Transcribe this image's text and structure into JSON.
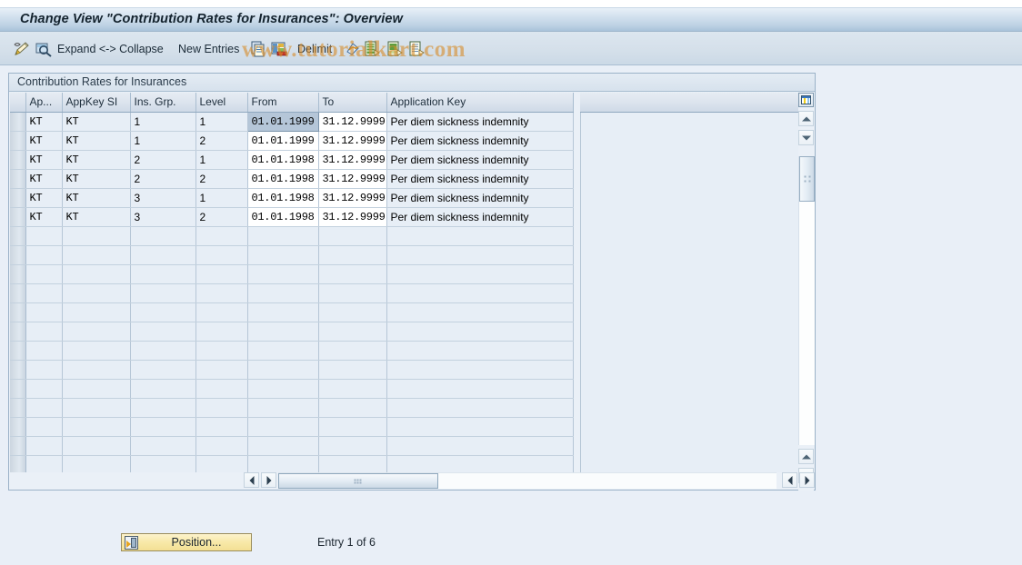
{
  "window": {
    "title": "Change View \"Contribution Rates for Insurances\": Overview"
  },
  "watermark": {
    "text": "www.tutorialkart.com"
  },
  "toolbar": {
    "items": [
      {
        "name": "display-change-icon",
        "label": "",
        "icon": "pencil-icon"
      },
      {
        "name": "display-detail-icon",
        "label": "",
        "icon": "magnifier-icon"
      },
      {
        "name": "expand-collapse",
        "label": "Expand <-> Collapse",
        "icon": ""
      },
      {
        "name": "new-entries",
        "label": "New Entries",
        "icon": ""
      },
      {
        "name": "copy-as-icon",
        "label": "",
        "icon": "copy-icon"
      },
      {
        "name": "delete-icon",
        "label": "",
        "icon": "delete-row-icon"
      },
      {
        "name": "delimit",
        "label": "Delimit",
        "icon": ""
      },
      {
        "name": "undo-icon",
        "label": "",
        "icon": "undo-icon"
      },
      {
        "name": "previous-entry-icon",
        "label": "",
        "icon": "document-prev-icon"
      },
      {
        "name": "select-all-icon",
        "label": "",
        "icon": "document-select-icon"
      },
      {
        "name": "next-entry-icon",
        "label": "",
        "icon": "document-next-icon"
      }
    ]
  },
  "panel": {
    "header": "Contribution Rates for Insurances"
  },
  "table": {
    "columns": [
      {
        "key": "ap",
        "label": "Ap..."
      },
      {
        "key": "app",
        "label": "AppKey SI"
      },
      {
        "key": "ins",
        "label": "Ins. Grp."
      },
      {
        "key": "lvl",
        "label": "Level"
      },
      {
        "key": "from",
        "label": "From"
      },
      {
        "key": "to",
        "label": "To"
      },
      {
        "key": "key",
        "label": "Application Key"
      }
    ],
    "rows": [
      {
        "ap": "KT",
        "app": "KT",
        "ins": "1",
        "lvl": "1",
        "from": "01.01.1999",
        "to": "31.12.9999",
        "key": "Per diem sickness indemnity",
        "selected": true
      },
      {
        "ap": "KT",
        "app": "KT",
        "ins": "1",
        "lvl": "2",
        "from": "01.01.1999",
        "to": "31.12.9999",
        "key": "Per diem sickness indemnity",
        "selected": false
      },
      {
        "ap": "KT",
        "app": "KT",
        "ins": "2",
        "lvl": "1",
        "from": "01.01.1998",
        "to": "31.12.9999",
        "key": "Per diem sickness indemnity",
        "selected": false
      },
      {
        "ap": "KT",
        "app": "KT",
        "ins": "2",
        "lvl": "2",
        "from": "01.01.1998",
        "to": "31.12.9999",
        "key": "Per diem sickness indemnity",
        "selected": false
      },
      {
        "ap": "KT",
        "app": "KT",
        "ins": "3",
        "lvl": "1",
        "from": "01.01.1998",
        "to": "31.12.9999",
        "key": "Per diem sickness indemnity",
        "selected": false
      },
      {
        "ap": "KT",
        "app": "KT",
        "ins": "3",
        "lvl": "2",
        "from": "01.01.1998",
        "to": "31.12.9999",
        "key": "Per diem sickness indemnity",
        "selected": false
      }
    ],
    "empty_row_count": 13
  },
  "footer": {
    "position_button": "Position...",
    "entry_status": "Entry 1 of 6"
  },
  "colors": {
    "title_accent": "#a9c3da",
    "grid_row": "#e7eef6",
    "selected_cell": "#b5c6d8",
    "button_yellow": "#f8e9a9",
    "watermark": "#d68e2f"
  }
}
